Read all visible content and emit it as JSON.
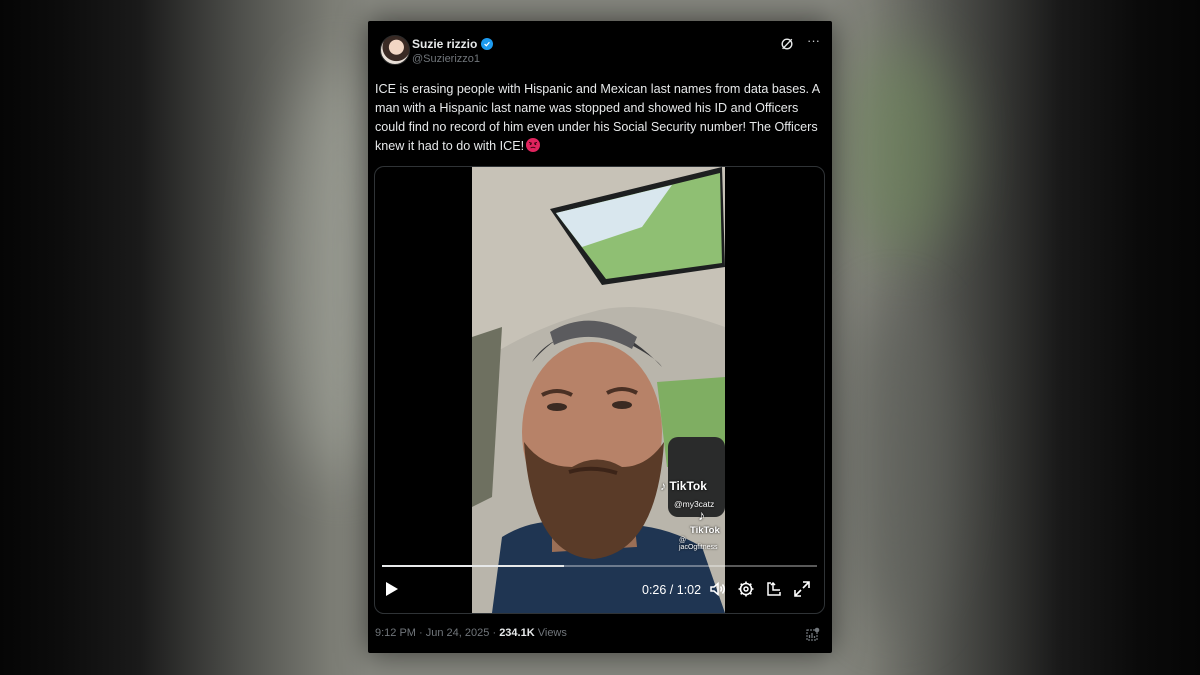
{
  "tweet": {
    "display_name": "Suzie rizzio",
    "handle": "@Suzierizzo1",
    "text": "ICE is erasing people with Hispanic and Mexican last names from data bases. A man with a Hispanic last name was stopped and showed his ID and Officers could find no record of him even under his Social Security number! The Officers knew it had to do with ICE!",
    "emoji": "angry-face-emoji"
  },
  "video": {
    "watermark_1_brand": "TikTok",
    "watermark_1_handle": "@my3catz",
    "watermark_2_brand": "TikTok",
    "watermark_2_handle": "@ jacOgfitness",
    "time_display": "0:26 / 1:02",
    "progress_fraction": 0.419,
    "icons": [
      "play-icon",
      "volume-icon",
      "settings-icon",
      "pop-out-icon",
      "fullscreen-icon"
    ]
  },
  "footer": {
    "time": "9:12 PM",
    "separator": "·",
    "date": "Jun 24, 2025",
    "views_count": "234.1K",
    "views_label": "Views"
  },
  "colors": {
    "background": "#000000",
    "text": "#e7e9ea",
    "secondary_text": "#71767b",
    "verified": "#1d9bf0"
  }
}
